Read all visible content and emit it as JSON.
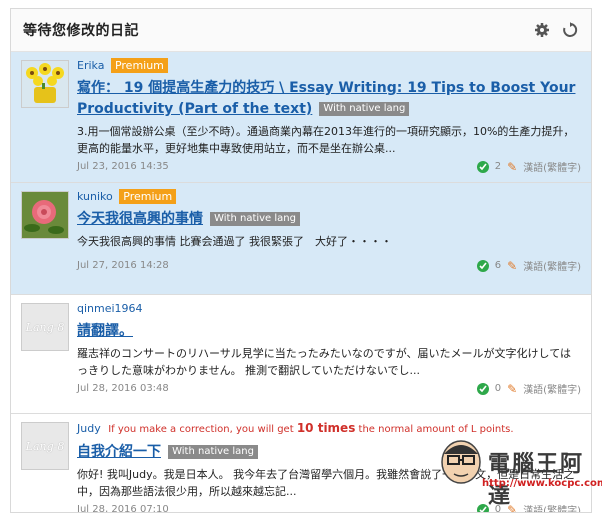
{
  "panel": {
    "title": "等待您修改的日記",
    "gear_icon": "gear-icon",
    "refresh_icon": "refresh-icon"
  },
  "entries": [
    {
      "user": "Erika",
      "badge": "Premium",
      "title": "寫作： 19 個提高生產力的技巧 \\ Essay Writing: 19 Tips to Boost Your Productivity (Part of the text)",
      "native": "With native lang",
      "excerpt": "3.用一個常設辦公桌（至少不時）。通過商業內幕在2013年進行的一項研究顯示，10%的生產力提升，更高的能量水平，更好地集中專致使用站立，而不是坐在辦公桌...",
      "date": "Jul 23, 2016 14:35",
      "corrections": "2",
      "language": "漢語(繁體字)"
    },
    {
      "user": "kuniko",
      "badge": "Premium",
      "title": "今天我很高興的事情",
      "native": "With native lang",
      "excerpt": "今天我很高興的事情 比賽会通過了 我很緊張了　大好了・・・・",
      "date": "Jul 27, 2016 14:28",
      "corrections": "6",
      "language": "漢語(繁體字)"
    },
    {
      "user": "qinmei1964",
      "avatar_text": "Lang-8",
      "title": "請翻譯。",
      "excerpt": "羅志祥のコンサートのリハーサル見学に当たったみたいなのですが、届いたメールが文字化けしてはっきりした意味がわかりません。 推測で翻訳していただけないでし...",
      "date": "Jul 28, 2016 03:48",
      "corrections": "0",
      "language": "漢語(繁體字)"
    },
    {
      "user": "Judy",
      "avatar_text": "Lang-8",
      "notice_pre": "If you make a correction, you will get",
      "notice_bold": "10 times",
      "notice_post": "the normal amount of L points.",
      "title": "自我介紹一下",
      "native": "With native lang",
      "excerpt": "你好! 我叫Judy。我是日本人。 我今年去了台灣留學六個月。我雖然會說了一點中文，但是日常生活之中，因為那些語法很少用，所以越來越忘記...",
      "date": "Jul 28, 2016 07:10",
      "corrections": "0",
      "language": "漢語(繁體字)"
    }
  ],
  "watermark": {
    "text": "電腦王阿達",
    "url": "http://www.kocpc.com.tw"
  }
}
